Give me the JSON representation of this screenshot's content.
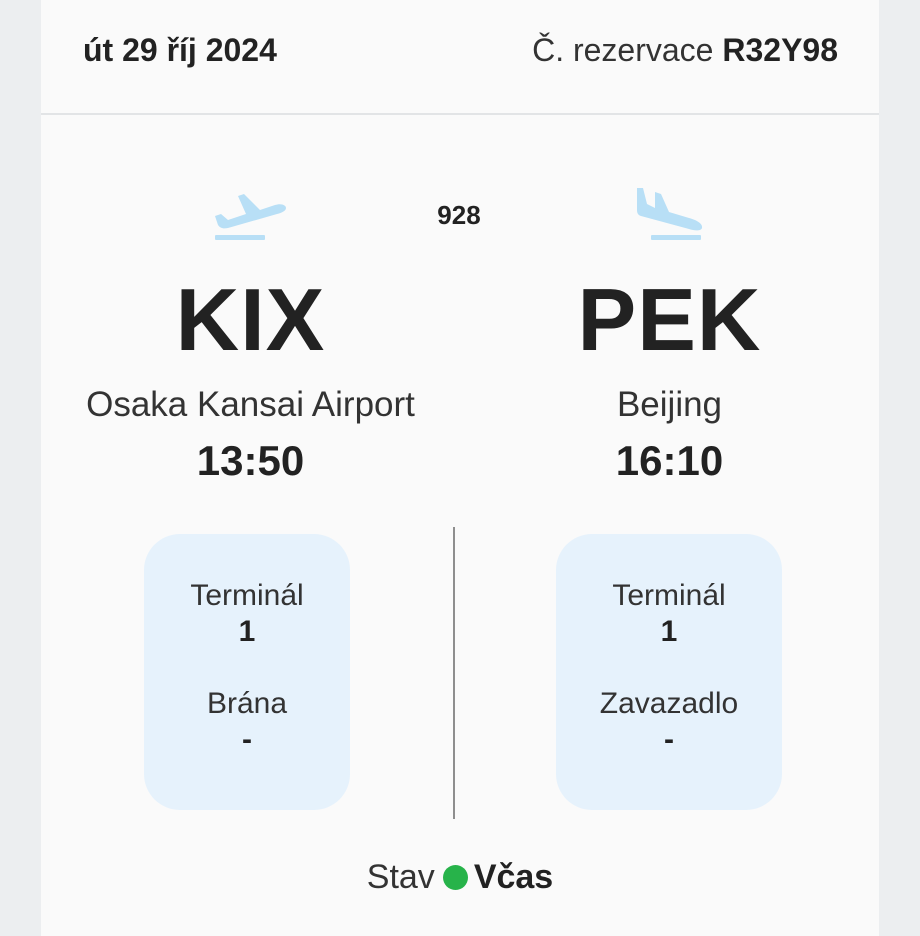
{
  "header": {
    "date": "út 29 říj 2024",
    "booking_label": "Č. rezervace",
    "booking_code": "R32Y98"
  },
  "flight": {
    "number": "928"
  },
  "departure": {
    "icon": "plane-takeoff-icon",
    "iata": "KIX",
    "city": "Osaka Kansai Airport",
    "time": "13:50",
    "terminal_label": "Terminál",
    "terminal_value": "1",
    "gate_label": "Brána",
    "gate_value": "-"
  },
  "arrival": {
    "icon": "plane-landing-icon",
    "iata": "PEK",
    "city": "Beijing",
    "time": "16:10",
    "terminal_label": "Terminál",
    "terminal_value": "1",
    "baggage_label": "Zavazadlo",
    "baggage_value": "-"
  },
  "status": {
    "label": "Stav",
    "value": "Včas",
    "color": "#27b34a"
  },
  "colors": {
    "icon": "#b8dff6",
    "info_box": "#e6f2fc"
  }
}
